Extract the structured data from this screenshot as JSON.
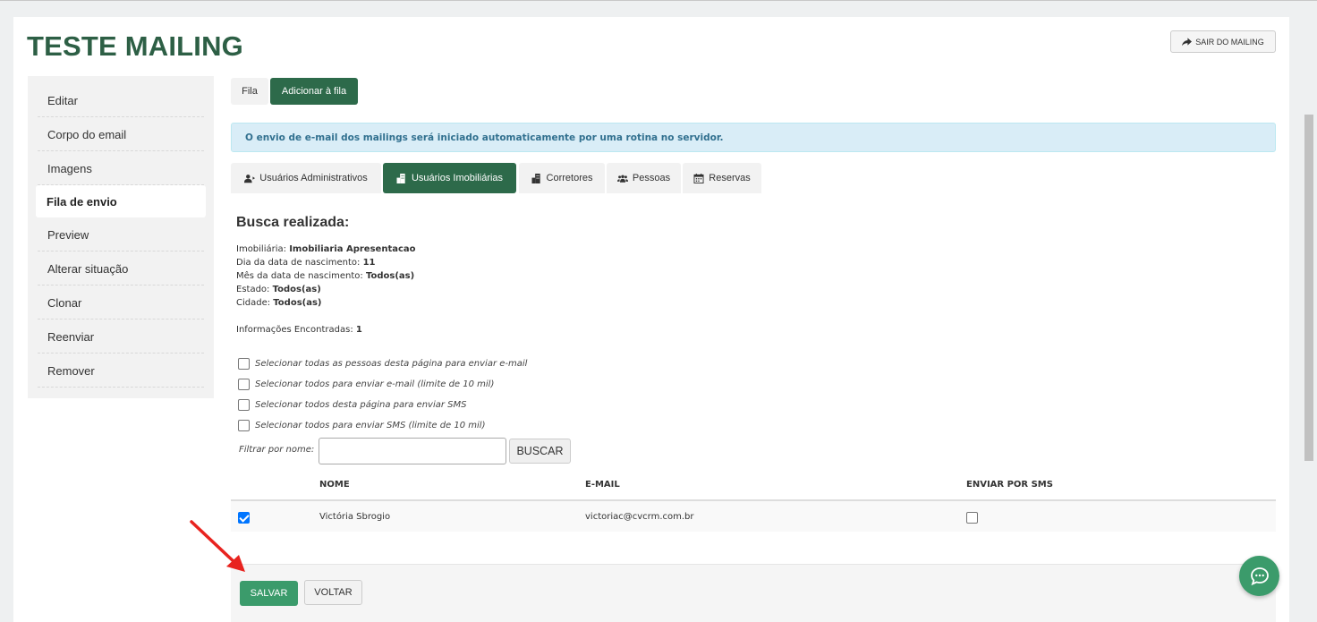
{
  "page": {
    "title": "TESTE MAILING",
    "exit_button": "SAIR DO MAILING"
  },
  "sidebar": {
    "items": [
      {
        "label": "Editar"
      },
      {
        "label": "Corpo do email"
      },
      {
        "label": "Imagens"
      },
      {
        "label": "Fila de envio",
        "active": true
      },
      {
        "label": "Preview"
      },
      {
        "label": "Alterar situação"
      },
      {
        "label": "Clonar"
      },
      {
        "label": "Reenviar"
      },
      {
        "label": "Remover"
      }
    ]
  },
  "top_tabs": [
    {
      "label": "Fila",
      "active": false
    },
    {
      "label": "Adicionar à fila",
      "active": true
    }
  ],
  "alert": "O envio de e-mail dos mailings será iniciado automaticamente por uma rotina no servidor.",
  "user_tabs": [
    {
      "label": "Usuários Administrativos",
      "icon": "user-arrow-icon",
      "active": false
    },
    {
      "label": "Usuários Imobiliárias",
      "icon": "building-icon",
      "active": true
    },
    {
      "label": "Corretores",
      "icon": "building-icon",
      "active": false
    },
    {
      "label": "Pessoas",
      "icon": "users-icon",
      "active": false
    },
    {
      "label": "Reservas",
      "icon": "calendar-icon",
      "active": false
    }
  ],
  "search": {
    "heading": "Busca realizada:",
    "fields": [
      {
        "label": "Imobiliária: ",
        "value": "Imobiliaria Apresentacao"
      },
      {
        "label": "Dia da data de nascimento: ",
        "value": "11"
      },
      {
        "label": "Mês da data de nascimento: ",
        "value": "Todos(as)"
      },
      {
        "label": "Estado: ",
        "value": "Todos(as)"
      },
      {
        "label": "Cidade: ",
        "value": "Todos(as)"
      }
    ],
    "found_label": "Informações Encontradas: ",
    "found_value": "1"
  },
  "select_options": [
    {
      "label": "Selecionar todas as pessoas desta página para enviar e-mail",
      "checked": false
    },
    {
      "label": "Selecionar todos para enviar e-mail (limite de 10 mil)",
      "checked": false
    },
    {
      "label": "Selecionar todos desta página para enviar SMS",
      "checked": false
    },
    {
      "label": "Selecionar todos para enviar SMS (limite de 10 mil)",
      "checked": false
    }
  ],
  "filter": {
    "label": "Filtrar por nome:",
    "value": "",
    "button": "BUSCAR"
  },
  "table": {
    "columns": [
      "NOME",
      "E-MAIL",
      "ENVIAR POR SMS"
    ],
    "rows": [
      {
        "selected": true,
        "name": "Victória Sbrogio",
        "email": "victoriac@cvcrm.com.br",
        "sms": false
      }
    ]
  },
  "footer": {
    "save": "SALVAR",
    "back": "VOLTAR"
  },
  "colors": {
    "brand": "#2d6a4a",
    "save": "#3b9b6b",
    "alert_bg": "#d9edf7",
    "annotation_arrow": "#e8231f"
  }
}
